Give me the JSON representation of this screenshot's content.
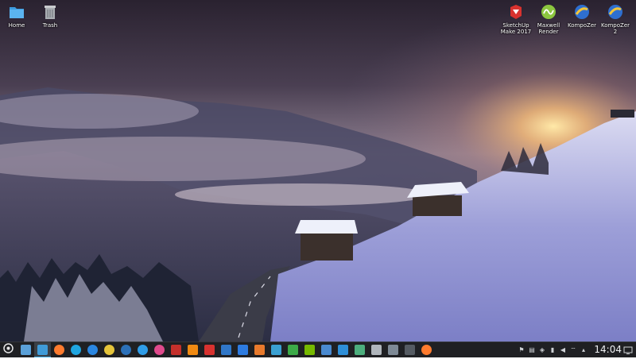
{
  "desktop": {
    "icons": [
      {
        "label": "Home",
        "icon": "folder-icon"
      },
      {
        "label": "Trash",
        "icon": "trash-icon"
      },
      {
        "label": "SketchUp\nMake 2017",
        "icon": "sketchup-icon"
      },
      {
        "label": "Maxwell\nRender",
        "icon": "maxwell-icon"
      },
      {
        "label": "KompoZer",
        "icon": "kompozer-icon"
      },
      {
        "label": "KompoZer\n2",
        "icon": "kompozer-icon"
      }
    ]
  },
  "panel": {
    "clock": "14:04",
    "tasks": [
      {
        "icon": "app-launcher-icon",
        "color": "#e8e8e8"
      },
      {
        "icon": "pager-icon",
        "color": "#5aa0d8"
      },
      {
        "icon": "file-manager-icon",
        "color": "#3f9bd8"
      },
      {
        "icon": "firefox-icon",
        "color": "#ff7b2e"
      },
      {
        "icon": "edge-icon",
        "color": "#1fa5e0"
      },
      {
        "icon": "browser-icon",
        "color": "#2a86e0"
      },
      {
        "icon": "kompozer-icon",
        "color": "#e5c43a"
      },
      {
        "icon": "steam-icon",
        "color": "#2b70b8"
      },
      {
        "icon": "discover-icon",
        "color": "#2f9de8"
      },
      {
        "icon": "record-icon",
        "color": "#e04a8c"
      },
      {
        "icon": "bug-icon",
        "color": "#c4302b"
      },
      {
        "icon": "vlc-icon",
        "color": "#f08a12"
      },
      {
        "icon": "sketchup-icon",
        "color": "#d8322f"
      },
      {
        "icon": "terminal-icon",
        "color": "#3077c8"
      },
      {
        "icon": "document-icon",
        "color": "#2d7be0"
      },
      {
        "icon": "presentation-icon",
        "color": "#e87a2c"
      },
      {
        "icon": "text-editor-icon",
        "color": "#3aa0d2"
      },
      {
        "icon": "spreadsheet-icon",
        "color": "#3caa48"
      },
      {
        "icon": "nvidia-icon",
        "color": "#76b900"
      },
      {
        "icon": "image-viewer-icon",
        "color": "#4a8ad0"
      },
      {
        "icon": "store-icon",
        "color": "#2e8fd8"
      },
      {
        "icon": "system-monitor-icon",
        "color": "#4cae7d"
      },
      {
        "icon": "calculator-icon",
        "color": "#b0b6bc"
      },
      {
        "icon": "screenshot-icon",
        "color": "#7e8a96"
      },
      {
        "icon": "console-icon",
        "color": "#555b62"
      },
      {
        "icon": "firefox-icon",
        "color": "#ff7b2e"
      }
    ],
    "tray": [
      {
        "icon": "notifications-icon",
        "glyph": "⚑"
      },
      {
        "icon": "clipboard-icon",
        "glyph": "▤"
      },
      {
        "icon": "updates-icon",
        "glyph": "◈"
      },
      {
        "icon": "battery-icon",
        "glyph": "▮"
      },
      {
        "icon": "volume-icon",
        "glyph": "◀"
      },
      {
        "icon": "network-icon",
        "glyph": "⌔"
      },
      {
        "icon": "tray-expand-icon",
        "glyph": "▴"
      }
    ]
  },
  "colors": {
    "panel_bg": "#1f2023",
    "accent": "#3daee9"
  }
}
